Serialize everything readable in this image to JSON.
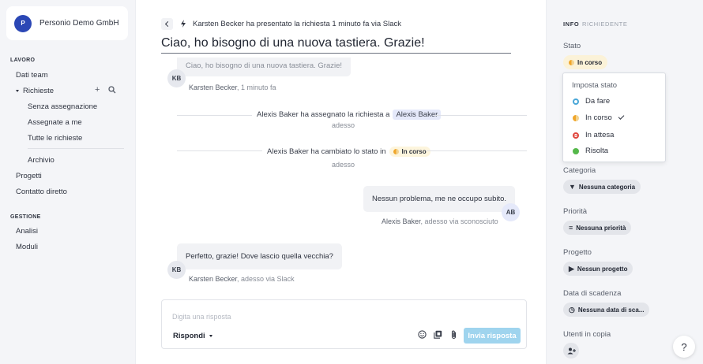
{
  "org": {
    "initial": "P",
    "name": "Personio Demo GmbH"
  },
  "sidebar": {
    "section_work": "LAVORO",
    "team_data": "Dati team",
    "requests": "Richieste",
    "unassigned": "Senza assegnazione",
    "assigned_to_me": "Assegnate a me",
    "all_requests": "Tutte le richieste",
    "archive": "Archivio",
    "projects": "Progetti",
    "direct_contact": "Contatto diretto",
    "section_management": "GESTIONE",
    "analytics": "Analisi",
    "modules": "Moduli",
    "add_icon": "plus-icon",
    "search_icon": "search-icon"
  },
  "header": {
    "line": "Karsten Becker ha presentato la richiesta 1 minuto fa via Slack",
    "title": "Ciao, ho bisogno di una nuova tastiera. Grazie!"
  },
  "timeline": {
    "msg1": {
      "text": "Ciao, ho bisogno di una nuova tastiera. Grazie!",
      "avatar": "KB",
      "author": "Karsten Becker",
      "time": ", 1 minuto fa"
    },
    "event1": {
      "text": "Alexis Baker ha assegnato la richiesta a",
      "assignee": "Alexis Baker",
      "time": "adesso"
    },
    "event2": {
      "text": "Alexis Baker ha cambiato lo stato in",
      "status": "In corso",
      "time": "adesso"
    },
    "msg2": {
      "text": "Nessun problema, me ne occupo subito.",
      "avatar": "AB",
      "author": "Alexis Baker",
      "time": ", adesso via sconosciuto"
    },
    "msg3": {
      "text": "Perfetto, grazie! Dove lascio quella vecchia?",
      "avatar": "KB",
      "author": "Karsten Becker",
      "time": ", adesso via Slack"
    }
  },
  "composer": {
    "placeholder": "Digita una risposta",
    "mode": "Rispondi",
    "send": "Invia risposta"
  },
  "panel": {
    "tab_info": "INFO",
    "tab_requester": "RICHIEDENTE",
    "status_label": "Stato",
    "status_value": "In corso",
    "dropdown_title": "Imposta stato",
    "options": [
      "Da fare",
      "In corso",
      "In attesa",
      "Risolta"
    ],
    "category_label": "Categoria",
    "category_value": "Nessuna categoria",
    "priority_label": "Priorità",
    "priority_value": "Nessuna priorità",
    "project_label": "Progetto",
    "project_value": "Nessun progetto",
    "due_label": "Data di scadenza",
    "due_value": "Nessuna data di sca...",
    "cc_label": "Utenti in copia",
    "help": "?"
  },
  "colors": {
    "accent": "#2b47b5",
    "send_button": "#9fd4ee",
    "status_in_progress": "#f0a62a",
    "status_todo": "#4aa7d8",
    "status_waiting": "#e0473e",
    "status_resolved": "#55b84a"
  }
}
